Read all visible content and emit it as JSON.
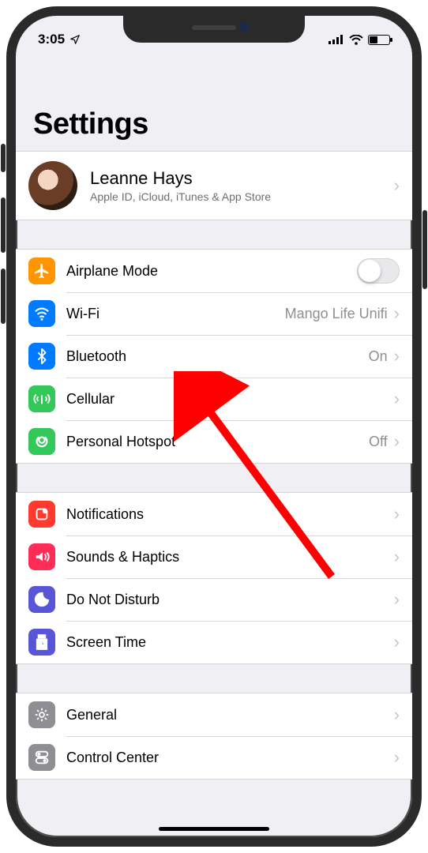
{
  "status": {
    "time": "3:05"
  },
  "header": {
    "title": "Settings"
  },
  "account": {
    "name": "Leanne Hays",
    "subtitle": "Apple ID, iCloud, iTunes & App Store"
  },
  "groups": [
    {
      "rows": [
        {
          "key": "airplane",
          "label": "Airplane Mode",
          "icon": "airplane-icon",
          "icon_bg": "#ff9500",
          "type": "switch",
          "on": false
        },
        {
          "key": "wifi",
          "label": "Wi-Fi",
          "icon": "wifi-icon",
          "icon_bg": "#007aff",
          "type": "link",
          "value": "Mango Life Unifi"
        },
        {
          "key": "bluetooth",
          "label": "Bluetooth",
          "icon": "bluetooth-icon",
          "icon_bg": "#007aff",
          "type": "link",
          "value": "On"
        },
        {
          "key": "cellular",
          "label": "Cellular",
          "icon": "cellular-icon",
          "icon_bg": "#34c759",
          "type": "link"
        },
        {
          "key": "hotspot",
          "label": "Personal Hotspot",
          "icon": "hotspot-icon",
          "icon_bg": "#34c759",
          "type": "link",
          "value": "Off"
        }
      ]
    },
    {
      "rows": [
        {
          "key": "notifications",
          "label": "Notifications",
          "icon": "notifications-icon",
          "icon_bg": "#ff3b30",
          "type": "link"
        },
        {
          "key": "sounds",
          "label": "Sounds & Haptics",
          "icon": "sounds-icon",
          "icon_bg": "#ff2d55",
          "type": "link"
        },
        {
          "key": "dnd",
          "label": "Do Not Disturb",
          "icon": "dnd-icon",
          "icon_bg": "#5856d6",
          "type": "link"
        },
        {
          "key": "screentime",
          "label": "Screen Time",
          "icon": "screentime-icon",
          "icon_bg": "#5856d6",
          "type": "link"
        }
      ]
    },
    {
      "rows": [
        {
          "key": "general",
          "label": "General",
          "icon": "gear-icon",
          "icon_bg": "#8e8e93",
          "type": "link"
        },
        {
          "key": "controlcenter",
          "label": "Control Center",
          "icon": "controlcenter-icon",
          "icon_bg": "#8e8e93",
          "type": "link"
        }
      ]
    }
  ],
  "annotation": {
    "target": "bluetooth"
  }
}
